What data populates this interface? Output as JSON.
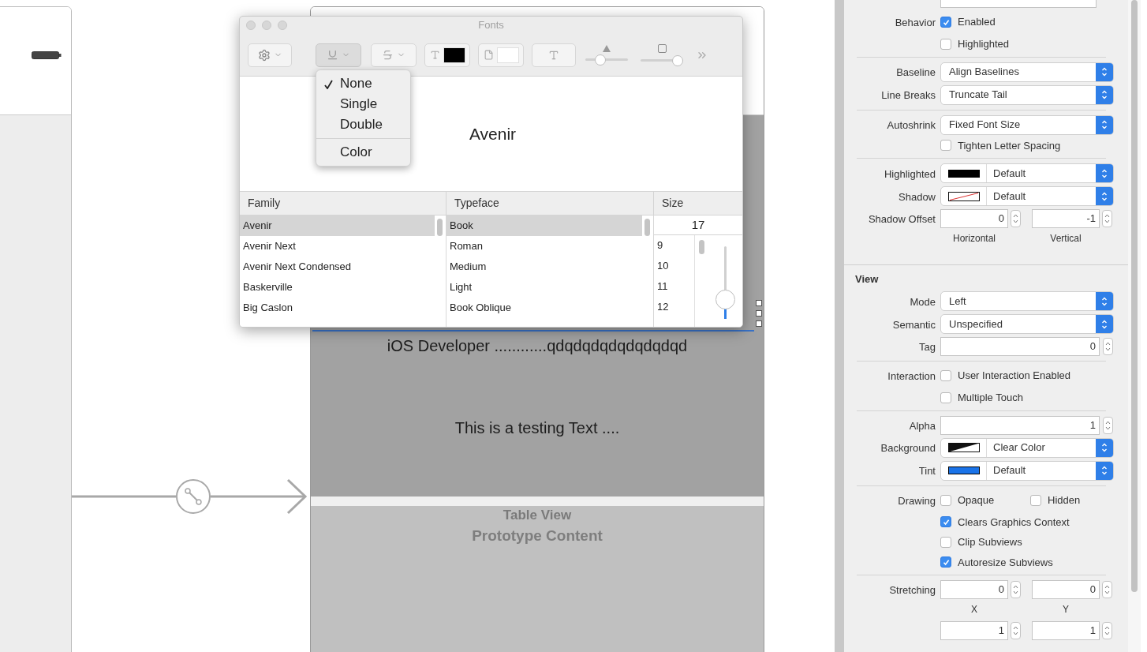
{
  "canvas": {
    "scene": {
      "labels": [
        "iOS Developer ............qdqdqdqdqdqdqdqd",
        "This is a testing Text ...."
      ],
      "table_view": {
        "title": "Table View",
        "subtitle": "Prototype Content"
      }
    }
  },
  "fonts_panel": {
    "title": "Fonts",
    "toolbar": [
      {
        "kind": "gear",
        "pressed": false
      },
      {
        "kind": "underline",
        "pressed": true
      },
      {
        "kind": "strike",
        "pressed": false
      },
      {
        "kind": "text_color",
        "pressed": false,
        "color": "#000000"
      },
      {
        "kind": "document_color",
        "pressed": false,
        "color": "#ffffff"
      },
      {
        "kind": "shadow",
        "pressed": false
      },
      {
        "kind": "slider",
        "level": 0.3
      },
      {
        "kind": "slider",
        "level": 1.0
      }
    ],
    "underline_menu": [
      {
        "kind": "item",
        "label": "None",
        "checked": true
      },
      {
        "kind": "item",
        "label": "Single",
        "checked": false
      },
      {
        "kind": "item",
        "label": "Double",
        "checked": false
      },
      {
        "kind": "separator"
      },
      {
        "kind": "item",
        "label": "Color",
        "checked": false
      }
    ],
    "preview": "Avenir",
    "columns": [
      "Family",
      "Typeface",
      "Size"
    ],
    "families": [
      {
        "label": "Avenir",
        "selected": true
      },
      {
        "label": "Avenir Next",
        "selected": false
      },
      {
        "label": "Avenir Next Condensed",
        "selected": false
      },
      {
        "label": "Baskerville",
        "selected": false
      },
      {
        "label": "Big Caslon",
        "selected": false
      }
    ],
    "typefaces": [
      {
        "label": "Book",
        "selected": true
      },
      {
        "label": "Roman",
        "selected": false
      },
      {
        "label": "Medium",
        "selected": false
      },
      {
        "label": "Light",
        "selected": false
      },
      {
        "label": "Book Oblique",
        "selected": false
      }
    ],
    "size": {
      "value": "17",
      "sizes": [
        "9",
        "10",
        "11",
        "12"
      ],
      "level": 0.15
    }
  },
  "inspector": {
    "rows": [
      {
        "kind": "field"
      },
      {
        "kind": "checks",
        "label": "Behavior",
        "items": [
          {
            "label": "Enabled",
            "checked": true
          },
          {
            "label": "Highlighted",
            "checked": false
          }
        ]
      },
      {
        "kind": "divider"
      },
      {
        "kind": "popup",
        "label": "Baseline",
        "value": "Align Baselines"
      },
      {
        "kind": "popup",
        "label": "Line Breaks",
        "value": "Truncate Tail"
      },
      {
        "kind": "divider"
      },
      {
        "kind": "popup",
        "label": "Autoshrink",
        "value": "Fixed Font Size"
      },
      {
        "kind": "checks",
        "label": "",
        "items": [
          {
            "label": "Tighten Letter Spacing",
            "checked": false
          }
        ]
      },
      {
        "kind": "divider"
      },
      {
        "kind": "color",
        "label": "Highlighted",
        "swatch": {
          "kind": "solid",
          "color": "#000000"
        },
        "value": "Default"
      },
      {
        "kind": "color",
        "label": "Shadow",
        "swatch": {
          "kind": "none"
        },
        "value": "Default"
      },
      {
        "kind": "pair",
        "label": "Shadow Offset",
        "values": [
          "0",
          "-1"
        ],
        "captions": [
          "Horizontal",
          "Vertical"
        ]
      },
      {
        "kind": "section",
        "label": "View"
      },
      {
        "kind": "popup",
        "label": "Mode",
        "value": "Left"
      },
      {
        "kind": "popup",
        "label": "Semantic",
        "value": "Unspecified"
      },
      {
        "kind": "stepper",
        "label": "Tag",
        "value": "0"
      },
      {
        "kind": "divider"
      },
      {
        "kind": "checks",
        "label": "Interaction",
        "items": [
          {
            "label": "User Interaction Enabled",
            "checked": false
          },
          {
            "label": "Multiple Touch",
            "checked": false
          }
        ]
      },
      {
        "kind": "divider"
      },
      {
        "kind": "stepper",
        "label": "Alpha",
        "value": "1"
      },
      {
        "kind": "color",
        "label": "Background",
        "swatch": {
          "kind": "clear"
        },
        "value": "Clear Color"
      },
      {
        "kind": "color",
        "label": "Tint",
        "swatch": {
          "kind": "solid",
          "color": "#1a73e8"
        },
        "value": "Default"
      },
      {
        "kind": "divider"
      },
      {
        "kind": "drawing",
        "label": "Drawing",
        "inline": [
          {
            "label": "Opaque",
            "checked": false
          },
          {
            "label": "Hidden",
            "checked": false
          }
        ],
        "items": [
          {
            "label": "Clears Graphics Context",
            "checked": true
          },
          {
            "label": "Clip Subviews",
            "checked": false
          },
          {
            "label": "Autoresize Subviews",
            "checked": true
          }
        ]
      },
      {
        "kind": "divider"
      },
      {
        "kind": "pair",
        "label": "Stretching",
        "values": [
          "0",
          "0"
        ],
        "captions": [
          "X",
          "Y"
        ]
      },
      {
        "kind": "pair",
        "label": "",
        "values": [
          "1",
          "1"
        ],
        "captions": []
      }
    ]
  }
}
